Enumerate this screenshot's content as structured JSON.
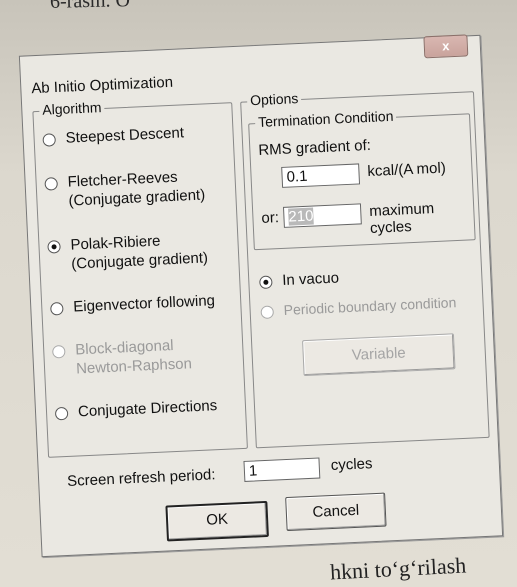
{
  "page": {
    "top_text": "6-rasm. O",
    "bottom_text": "hkni to‘g‘rilash"
  },
  "dialog": {
    "title": "Ab Initio Optimization",
    "close_label": "x",
    "algorithm": {
      "group_label": "Algorithm",
      "options": [
        {
          "line1": "Steepest Descent",
          "line2": "",
          "checked": false,
          "enabled": true
        },
        {
          "line1": "Fletcher-Reeves",
          "line2": "(Conjugate gradient)",
          "checked": false,
          "enabled": true
        },
        {
          "line1": "Polak-Ribiere",
          "line2": "(Conjugate gradient)",
          "checked": true,
          "enabled": true
        },
        {
          "line1": "Eigenvector following",
          "line2": "",
          "checked": false,
          "enabled": true
        },
        {
          "line1": "Block-diagonal",
          "line2": "Newton-Raphson",
          "checked": false,
          "enabled": false
        },
        {
          "line1": "Conjugate Directions",
          "line2": "",
          "checked": false,
          "enabled": true
        }
      ]
    },
    "options": {
      "group_label": "Options",
      "termination": {
        "group_label": "Termination Condition",
        "rms_label": "RMS gradient of:",
        "rms_value": "0.1",
        "rms_unit": "kcal/(A mol)",
        "or_label": "or:",
        "cycles_value": "210",
        "cycles_unit": "maximum cycles"
      },
      "in_vacuo_label": "In vacuo",
      "periodic_label": "Periodic boundary condition",
      "variable_button": "Variable"
    },
    "refresh_label": "Screen refresh period:",
    "refresh_value": "1",
    "refresh_unit": "cycles",
    "ok_label": "OK",
    "cancel_label": "Cancel"
  }
}
